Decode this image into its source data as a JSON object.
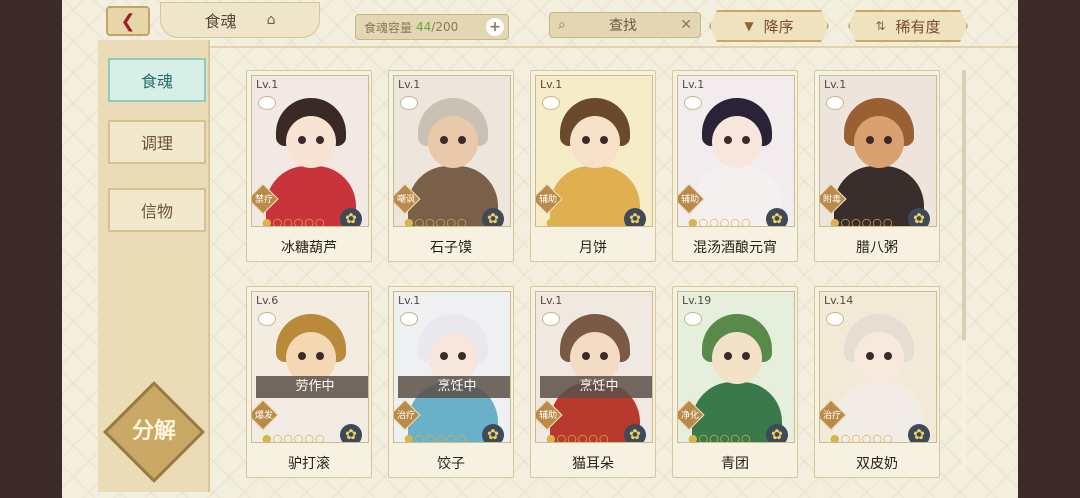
{
  "header": {
    "title": "食魂",
    "capacity_label": "食魂容量",
    "capacity_current": "44",
    "capacity_total": "/200",
    "search_label": "查找",
    "sort_order_label": "降序",
    "sort_by_label": "稀有度"
  },
  "menu": {
    "items": [
      {
        "label": "食魂"
      },
      {
        "label": "调理"
      },
      {
        "label": "信物"
      }
    ],
    "decompose_label": "分解"
  },
  "cards": [
    {
      "level": "Lv.1",
      "role": "禁疗",
      "name": "冰糖葫芦",
      "status": "",
      "hair": "#3a2a26",
      "face": "#f9e3d3",
      "body": "#c9343a",
      "bg": "#f2e8e4"
    },
    {
      "level": "Lv.1",
      "role": "嘲讽",
      "name": "石子馍",
      "status": "",
      "hair": "#c9c1b4",
      "face": "#e9c9a9",
      "body": "#7a6048",
      "bg": "#ece6dc"
    },
    {
      "level": "Lv.1",
      "role": "辅助",
      "name": "月饼",
      "status": "",
      "hair": "#6a4a2a",
      "face": "#f7e1c8",
      "body": "#e0b050",
      "bg": "#f6ecc8"
    },
    {
      "level": "Lv.1",
      "role": "辅助",
      "name": "混汤酒酿元宵",
      "status": "",
      "hair": "#2a2236",
      "face": "#f8e6dc",
      "body": "#f4f0f0",
      "bg": "#f2ecee"
    },
    {
      "level": "Lv.1",
      "role": "附毒",
      "name": "腊八粥",
      "status": "",
      "hair": "#9a6034",
      "face": "#d9a070",
      "body": "#3a2e2c",
      "bg": "#ede5dc"
    },
    {
      "level": "Lv.6",
      "role": "爆发",
      "name": "驴打滚",
      "status": "劳作中",
      "hair": "#b88a3a",
      "face": "#f4d8b4",
      "body": "#f0ece4",
      "bg": "#f3ece0"
    },
    {
      "level": "Lv.1",
      "role": "治疗",
      "name": "饺子",
      "status": "烹饪中",
      "hair": "#e8e8ee",
      "face": "#f7e6dc",
      "body": "#6ab0c8",
      "bg": "#eef0f2"
    },
    {
      "level": "Lv.1",
      "role": "辅助",
      "name": "猫耳朵",
      "status": "烹饪中",
      "hair": "#7a5a44",
      "face": "#f4dcc4",
      "body": "#b83a2e",
      "bg": "#efe9e2"
    },
    {
      "level": "Lv.19",
      "role": "净化",
      "name": "青团",
      "status": "",
      "hair": "#5a8a4a",
      "face": "#f3e1c8",
      "body": "#3a7a4a",
      "bg": "#e6efdc"
    },
    {
      "level": "Lv.14",
      "role": "治疗",
      "name": "双皮奶",
      "status": "",
      "hair": "#e6ded2",
      "face": "#f7e9dc",
      "body": "#f2ece6",
      "bg": "#f2ead6"
    }
  ]
}
